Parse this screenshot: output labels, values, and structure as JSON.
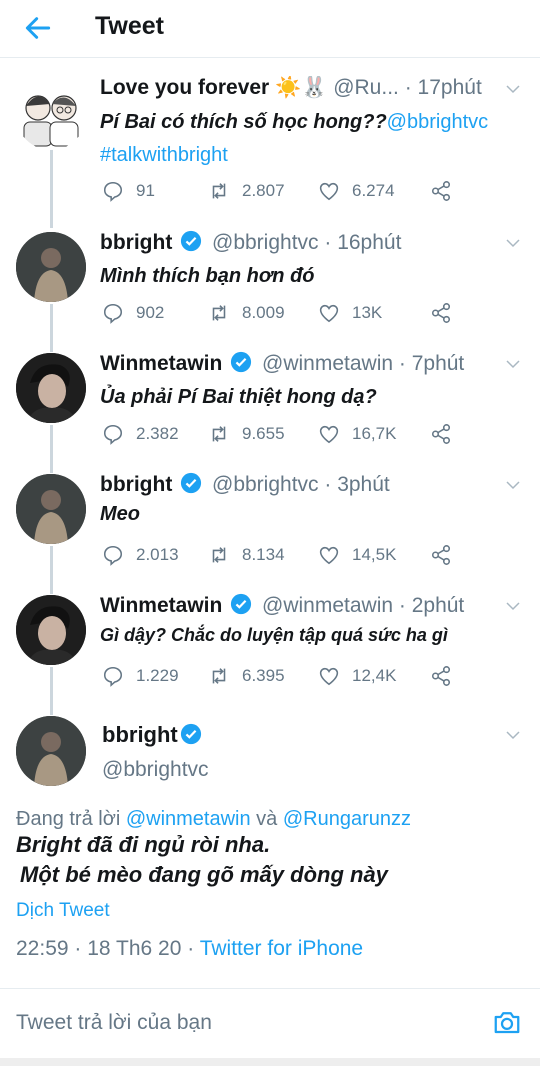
{
  "header": {
    "title": "Tweet"
  },
  "colors": {
    "accent": "#1da1f2",
    "muted": "#657786",
    "divider": "#e6ecf0"
  },
  "tweets": [
    {
      "name": "Love you forever ☀️🐰",
      "handle": "@Ru...",
      "time": "17phút",
      "text": "Pí Bai có thích số học hong??",
      "link1": "@bbrightvc",
      "link2": "#talkwithbright",
      "replies": "91",
      "retweets": "2.807",
      "likes": "6.274"
    },
    {
      "name": "bbright",
      "handle": "@bbrightvc",
      "time": "16phút",
      "text": "Mình thích bạn hơn đó",
      "replies": "902",
      "retweets": "8.009",
      "likes": "13K"
    },
    {
      "name": "Winmetawin",
      "handle": "@winmetawin",
      "time": "7phút",
      "text": "Ủa phải Pí Bai thiệt hong dạ?",
      "replies": "2.382",
      "retweets": "9.655",
      "likes": "16,7K"
    },
    {
      "name": "bbright",
      "handle": "@bbrightvc",
      "time": "3phút",
      "text": "Meo",
      "replies": "2.013",
      "retweets": "8.134",
      "likes": "14,5K"
    },
    {
      "name": "Winmetawin",
      "handle": "@winmetawin",
      "time": "2phút",
      "text": "Gì dậy? Chắc do luyện tập quá sức ha gì",
      "replies": "1.229",
      "retweets": "6.395",
      "likes": "12,4K"
    }
  ],
  "main": {
    "name": "bbright",
    "handle": "@bbrightvc",
    "reply_prefix": "Đang trả lời ",
    "reply_user1": "@winmetawin",
    "reply_and": " và ",
    "reply_user2": "@Rungarunzz",
    "line1": "Bright đã đi ngủ ròi nha.",
    "line2": "Một bé mèo đang gõ mấy dòng này",
    "translate": "Dịch Tweet",
    "timestamp": "22:59 · 18 Th6 20 · ",
    "client": "Twitter for iPhone"
  },
  "reply_bar": {
    "placeholder": "Tweet trả lời của bạn"
  }
}
